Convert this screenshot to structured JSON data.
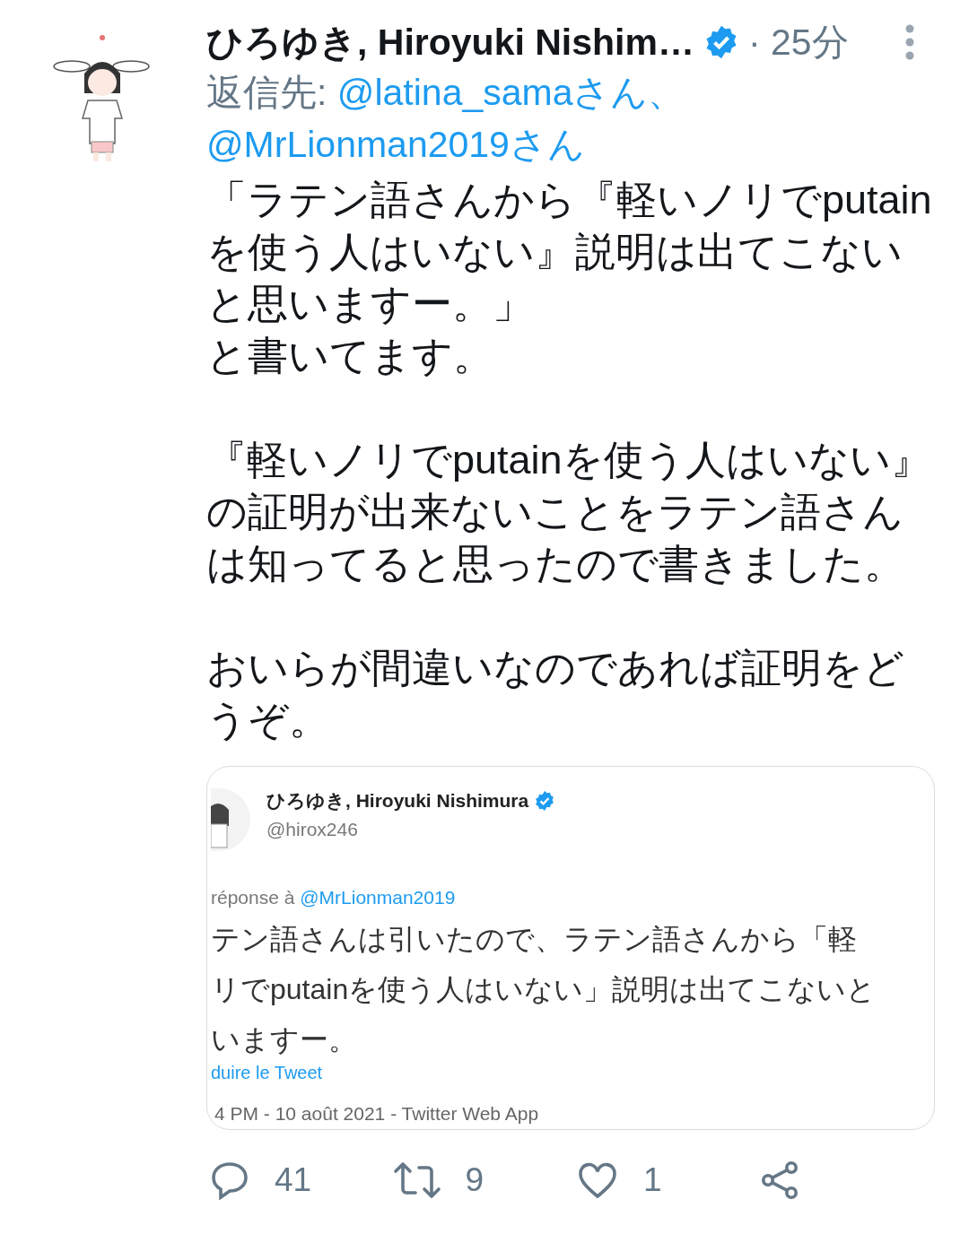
{
  "tweet": {
    "name": "ひろゆき, Hiroyuki Nishim…",
    "verified": true,
    "time": "· 25分",
    "reply_label": "返信先:",
    "reply_to": [
      "@latina_samaさん、",
      "@MrLionman2019さん"
    ],
    "paragraphs": [
      [
        "「ラテン語さんから『軽いノリでputainを使う人はいない』説明は出てこないと思いますー。」",
        "と書いてます。"
      ],
      [
        "『軽いノリでputainを使う人はいない』の証明が出来ないことをラテン語さんは知ってると思ったので書きました。"
      ],
      [
        "おいらが間違いなのであれば証明をどうぞ。"
      ]
    ],
    "embedded": {
      "name": "ひろゆき, Hiroyuki Nishimura",
      "verified": true,
      "handle": "@hirox246",
      "reply_label": "réponse à",
      "reply_to": "@MrLionman2019",
      "lines": [
        "テン語さんは引いたので、ラテン語さんから「軽",
        "リでputainを使う人はいない」説明は出てこないと",
        "いますー。"
      ],
      "translate": "duire le Tweet",
      "meta": "4 PM - 10 août 2021 - Twitter Web App"
    },
    "actions": [
      {
        "kind": "reply",
        "count": "41"
      },
      {
        "kind": "retweet",
        "count": "9"
      },
      {
        "kind": "like",
        "count": "1"
      },
      {
        "kind": "share"
      }
    ]
  }
}
